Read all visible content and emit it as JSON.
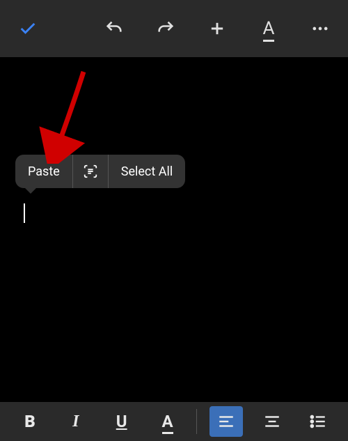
{
  "contextMenu": {
    "paste": "Paste",
    "selectAll": "Select All"
  },
  "topToolbar": {
    "check": "confirm",
    "undo": "undo",
    "redo": "redo",
    "add": "add",
    "textFormat": "A",
    "more": "more"
  },
  "bottomToolbar": {
    "bold": "B",
    "italic": "I",
    "underline": "U",
    "textColor": "A"
  }
}
